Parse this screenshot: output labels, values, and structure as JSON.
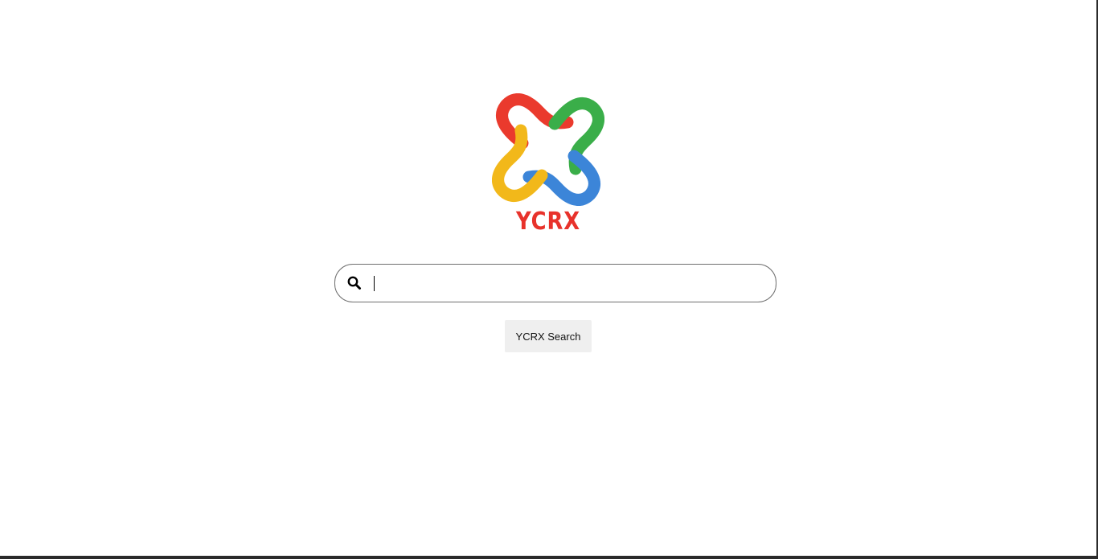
{
  "logo": {
    "text": "YCRX",
    "colors": {
      "red": "#ea3a2d",
      "green": "#3aae49",
      "yellow": "#f2b81a",
      "blue": "#3c85d8"
    }
  },
  "search": {
    "placeholder": "",
    "value": "",
    "icon": "search-icon"
  },
  "search_button": {
    "label": "YCRX Search"
  }
}
